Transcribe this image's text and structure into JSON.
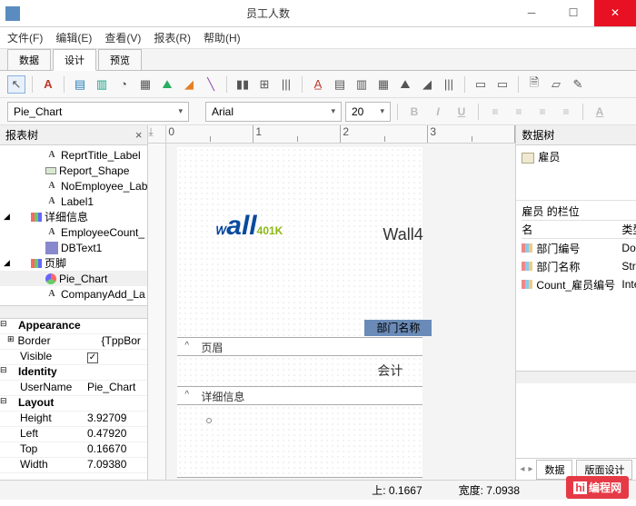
{
  "window": {
    "title": "员工人数"
  },
  "menu": {
    "file": "文件(F)",
    "edit": "编辑(E)",
    "view": "查看(V)",
    "report": "报表(R)",
    "help": "帮助(H)"
  },
  "tabs": {
    "data": "数据",
    "design": "设计",
    "preview": "预览"
  },
  "fmtbar": {
    "element_name": "Pie_Chart",
    "font": "Arial",
    "size": "20"
  },
  "left": {
    "tree_title": "报表树",
    "items": {
      "reprt_title": "ReprtTitle_Label",
      "report_shape": "Report_Shape",
      "noemployee": "NoEmployee_Lab",
      "label1": "Label1",
      "detail": "详细信息",
      "employee_count": "EmployeeCount_",
      "dbtext1": "DBText1",
      "footer": "页脚",
      "pie_chart": "Pie_Chart",
      "company_add": "CompanyAdd_La"
    },
    "props": {
      "appearance": "Appearance",
      "border": "Border",
      "border_v": "{TppBor",
      "visible": "Visible",
      "identity": "Identity",
      "username": "UserName",
      "username_v": "Pie_Chart",
      "layout": "Layout",
      "height": "Height",
      "height_v": "3.92709",
      "left": "Left",
      "left_v": "0.47920",
      "top": "Top",
      "top_v": "0.16670",
      "width": "Width",
      "width_v": "7.09380"
    }
  },
  "ruler": {
    "r0": "0",
    "r1": "1",
    "r2": "2",
    "r3": "3"
  },
  "canvas": {
    "logo_suffix": "Wall4",
    "band_header": "部门名称",
    "page_header": "页眉",
    "detail": "详细信息",
    "value": "会计"
  },
  "right": {
    "tree_title": "数据树",
    "root": "雇员",
    "fields_title": "雇员 的栏位",
    "col_name": "名",
    "col_type": "类型",
    "f1_name": "部门编号",
    "f1_type": "Double",
    "f2_name": "部门名称",
    "f2_type": "String",
    "f3_name": "Count_雇员编号",
    "f3_type": "Integer",
    "tab_data": "数据",
    "tab_layout": "版面设计"
  },
  "status": {
    "top_lbl": "上: 0.1667",
    "width_lbl": "宽度: 7.0938"
  },
  "watermark": "编程网"
}
